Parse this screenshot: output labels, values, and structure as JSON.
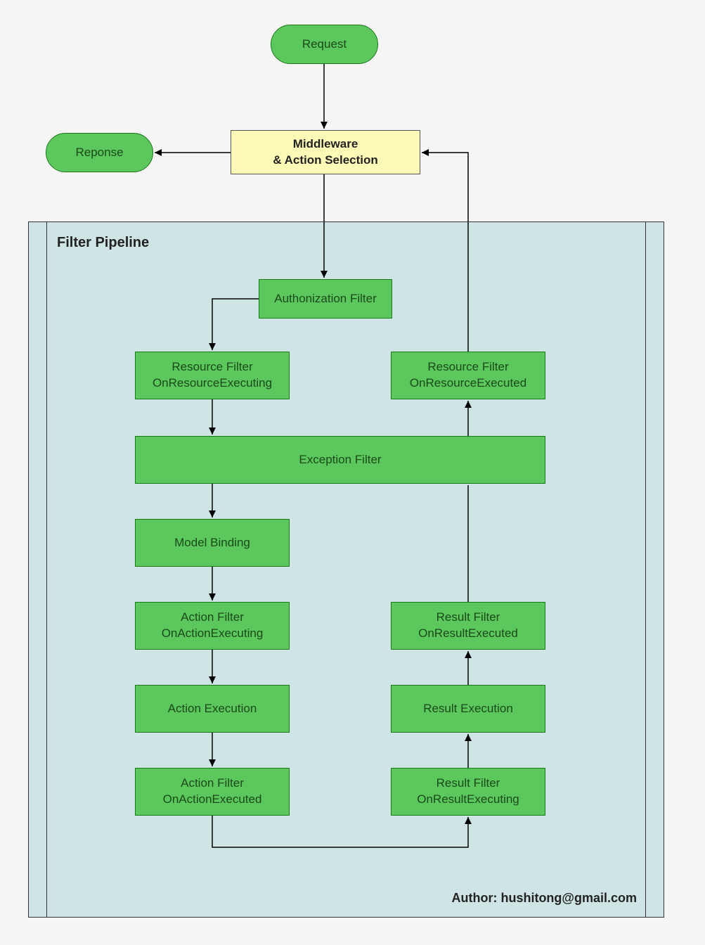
{
  "request": "Request",
  "response": "Reponse",
  "middleware_l1": "Middleware",
  "middleware_l2": "& Action Selection",
  "pipeline_title": "Filter Pipeline",
  "auth_filter": "Authonization Filter",
  "resource_executing_l1": "Resource Filter",
  "resource_executing_l2": "OnResourceExecuting",
  "resource_executed_l1": "Resource Filter",
  "resource_executed_l2": "OnResourceExecuted",
  "exception_filter": "Exception Filter",
  "model_binding": "Model Binding",
  "action_executing_l1": "Action Filter",
  "action_executing_l2": "OnActionExecuting",
  "action_execution": "Action Execution",
  "action_executed_l1": "Action Filter",
  "action_executed_l2": "OnActionExecuted",
  "result_executing_l1": "Result Filter",
  "result_executing_l2": "OnResultExecuting",
  "result_execution": "Result Execution",
  "result_executed_l1": "Result Filter",
  "result_executed_l2": "OnResultExecuted",
  "author": "Author:  hushitong@gmail.com"
}
